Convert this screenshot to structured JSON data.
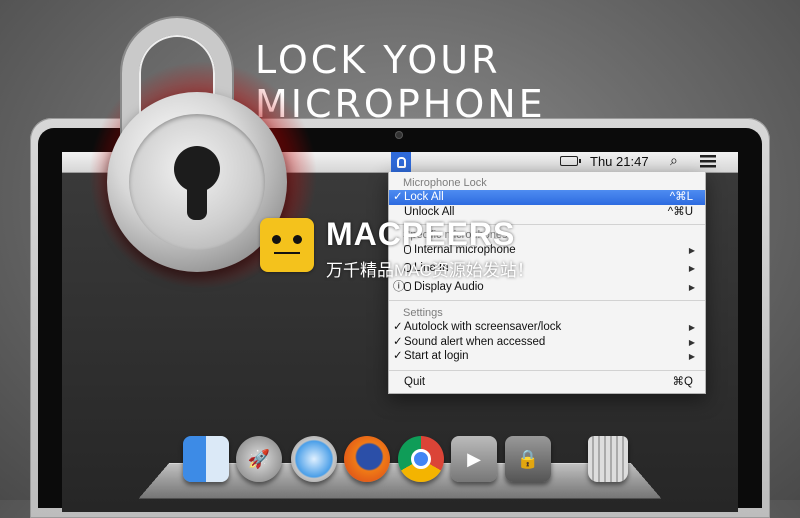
{
  "headline": "LOCK YOUR MICROPHONE",
  "menubar": {
    "apple": "",
    "clock": "Thu 21:47",
    "spotlight": "⌕"
  },
  "menu": {
    "section_microphone_lock": "Microphone Lock",
    "lock_all": {
      "check": "✓",
      "label": "Lock All",
      "shortcut": "^⌘L"
    },
    "unlock_all": {
      "label": "Unlock All",
      "shortcut": "^⌘U"
    },
    "section_specific": "Specific microphones",
    "internal_microphone": "Internal microphone",
    "line_in": "Line In",
    "display_audio": "Display Audio",
    "section_settings": "Settings",
    "autolock": {
      "check": "✓",
      "label": "Autolock with screensaver/lock"
    },
    "sound_alert": {
      "check": "✓",
      "label": "Sound alert when accessed"
    },
    "start_at_login": {
      "check": "✓",
      "label": "Start at login"
    },
    "quit": {
      "label": "Quit",
      "shortcut": "⌘Q"
    },
    "arrow": "▶"
  },
  "watermark": {
    "title": "MACPEERS",
    "subtitle": "万千精品MAC资源始发站！"
  },
  "colors": {
    "selection": "#2d6be0",
    "glow": "#e01818",
    "watermark_logo": "#f4c21c"
  }
}
